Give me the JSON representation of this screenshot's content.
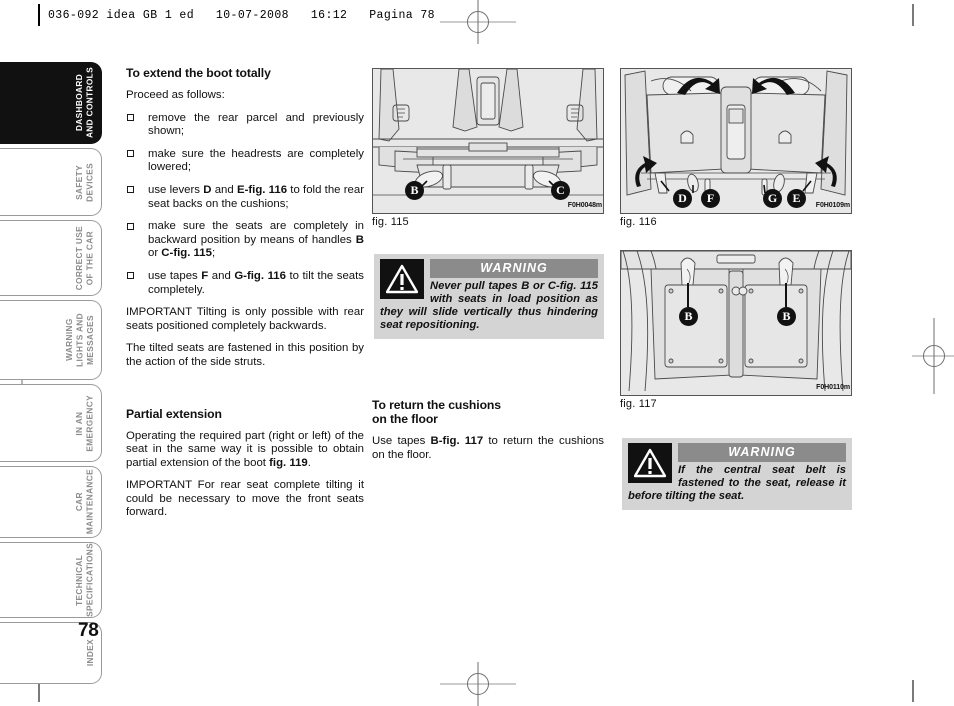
{
  "document": {
    "header_line": "036-092 idea GB 1 ed   10-07-2008   16:12   Pagina 78",
    "page_number": "78"
  },
  "sidebar": {
    "tabs": [
      {
        "label": "DASHBOARD\nAND CONTROLS",
        "active": true
      },
      {
        "label": "SAFETY\nDEVICES",
        "active": false
      },
      {
        "label": "CORRECT USE\nOF THE CAR",
        "active": false
      },
      {
        "label": "WARNING\nLIGHTS AND\nMESSAGES",
        "active": false
      },
      {
        "label": "IN AN\nEMERGENCY",
        "active": false
      },
      {
        "label": "CAR\nMAINTENANCE",
        "active": false
      },
      {
        "label": "TECHNICAL\nSPECIFICATIONS",
        "active": false
      },
      {
        "label": "INDEX",
        "active": false
      }
    ]
  },
  "column_one": {
    "heading": "To extend the boot totally",
    "intro": "Proceed as follows:",
    "bullets": [
      "remove the rear parcel and previously shown;",
      "make sure the headrests are completely lowered;",
      "use levers <b>D</b> and <b>E-fig. 116</b> to fold the rear seat backs on the cushions;",
      "make sure the seats are completely in backward position by means of handles <b>B</b> or <b>C-fig. 115</b>;",
      "use tapes <b>F</b> and <b>G-fig. 116</b> to tilt the seats completely."
    ],
    "important_one": "IMPORTANT Tilting is only possible with rear seats positioned completely backwards.",
    "paragraph_two": "The tilted seats are fastened in this position by the action of the side struts.",
    "heading_two": "Partial extension",
    "paragraph_three": "Operating the required part (right or left) of the seat in the same way it is possible to obtain partial extension of the boot <b>fig. 119</b>.",
    "important_two": "IMPORTANT For rear seat complete tilting it could be necessary to move the front seats forward."
  },
  "column_two": {
    "figure_115": {
      "caption": "fig. 115",
      "code": "F0H0048m",
      "callouts": [
        "B",
        "C"
      ]
    },
    "warning_one": {
      "title": "WARNING",
      "icon": "warning-triangle-icon",
      "text": "Never pull tapes B or C-fig. 115 with seats in load position as they will slide vertically thus hindering seat repositioning."
    },
    "heading": "To return the cushions\non the floor",
    "paragraph": "Use tapes <b>B-fig. 117</b> to return the cushions on the floor."
  },
  "column_three": {
    "figure_116": {
      "caption": "fig. 116",
      "code": "F0H0109m",
      "callouts": [
        "D",
        "F",
        "G",
        "E"
      ]
    },
    "figure_117": {
      "caption": "fig. 117",
      "code": "F0H0110m",
      "callouts": [
        "B",
        "B"
      ]
    },
    "warning_two": {
      "title": "WARNING",
      "icon": "warning-triangle-icon",
      "text": "If the central seat belt is fastened to the seat, release it before tilting the seat."
    }
  },
  "colors": {
    "active_tab_bg": "#111111",
    "tab_border": "#9a9a9a",
    "tab_text": "#8c8c8c",
    "warning_bg": "#d4d4d4",
    "warning_title_bg": "#8b8b8b",
    "figure_bg": "#e8e8e8"
  }
}
